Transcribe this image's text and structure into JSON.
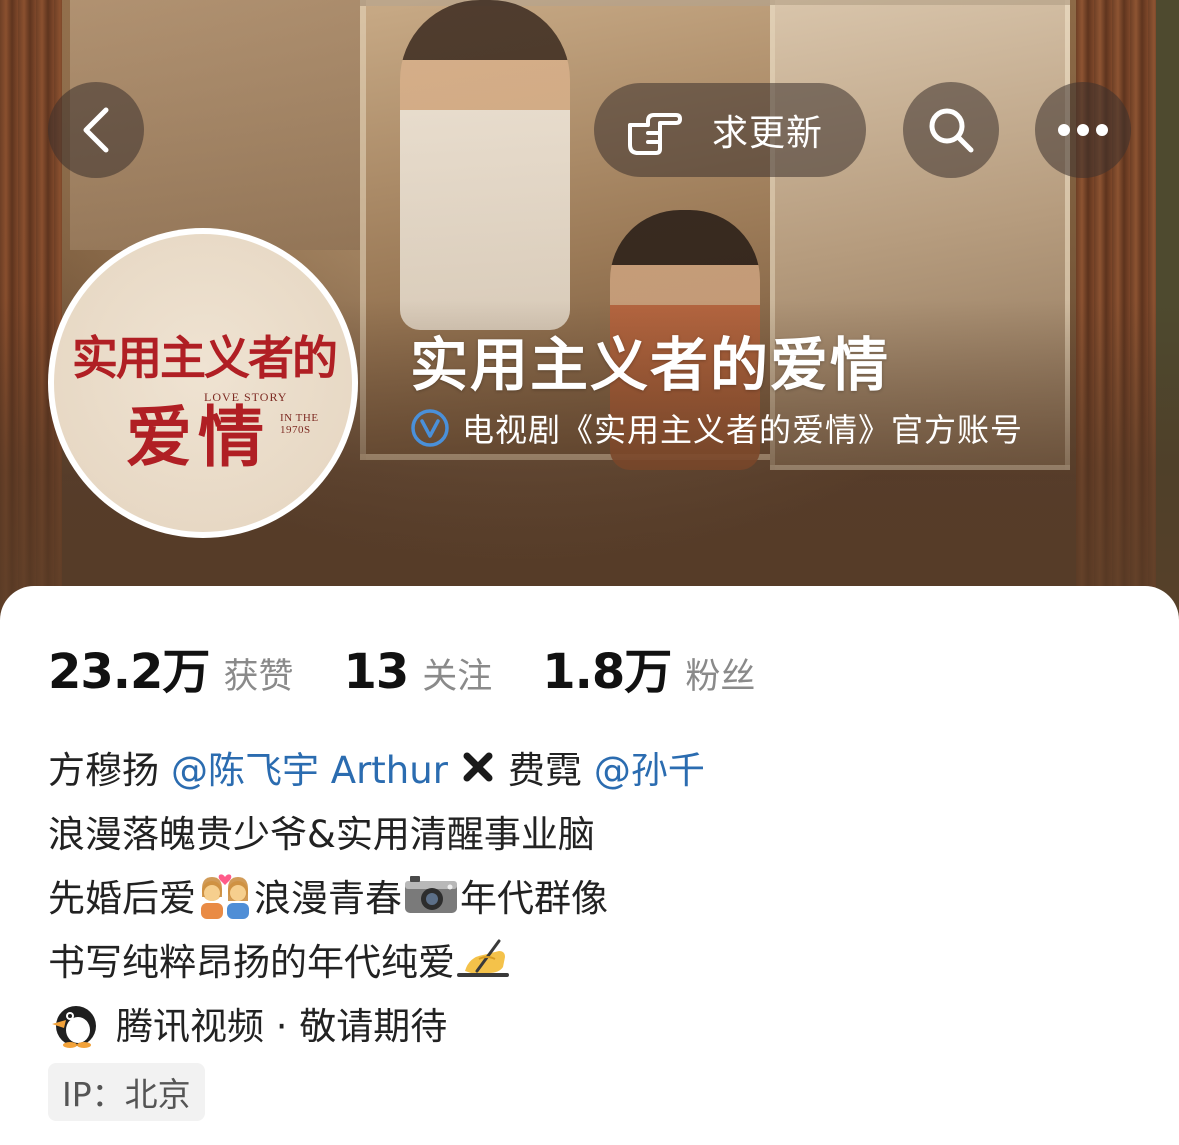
{
  "header": {
    "back_icon": "chevron-left-icon",
    "update_button_label": "求更新",
    "update_icon": "pointing-hand-icon",
    "search_icon": "search-icon",
    "more_icon": "ellipsis-icon"
  },
  "avatar": {
    "title_line1": "实用主义者的",
    "title_line2": "爱情",
    "english_line1": "LOVE STORY",
    "english_line2": "IN THE 1970S"
  },
  "profile": {
    "name": "实用主义者的爱情",
    "verification_icon": "verified-v-icon",
    "verification_text": "电视剧《实用主义者的爱情》官方账号"
  },
  "stats": [
    {
      "value": "23.2万",
      "label": "获赞"
    },
    {
      "value": "13",
      "label": "关注"
    },
    {
      "value": "1.8万",
      "label": "粉丝"
    }
  ],
  "bio": {
    "line1": {
      "part1": "方穆扬",
      "mention1": "@陈飞宇 Arthur",
      "separator_icon": "cross-mark-icon",
      "part2": "费霓",
      "mention2": "@孙千"
    },
    "line2": "浪漫落魄贵少爷&实用清醒事业脑",
    "line3": {
      "part1": "先婚后爱",
      "emoji1": "couple-with-heart-icon",
      "part2": "浪漫青春",
      "emoji2": "camera-icon",
      "part3": "年代群像"
    },
    "line4": {
      "text": "书写纯粹昂扬的年代纯爱",
      "emoji": "writing-hand-icon"
    },
    "line5": {
      "emoji": "penguin-icon",
      "text": "腾讯视频 · 敬请期待"
    }
  },
  "ip_label": "IP：北京",
  "colors": {
    "mention": "#2b6cb0",
    "verify_badge": "#4a90d9",
    "avatar_title": "#b01f24"
  }
}
